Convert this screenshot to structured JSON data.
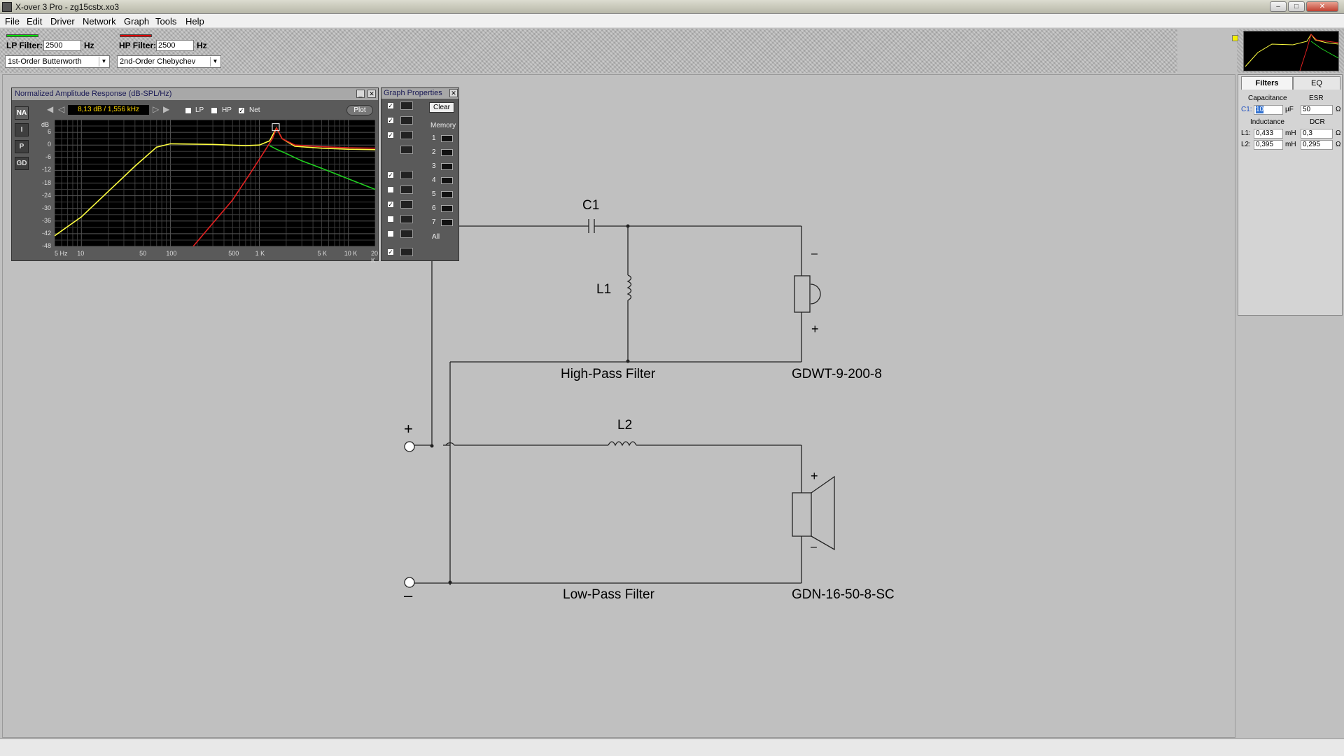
{
  "window": {
    "title": "X-over 3 Pro  -  zg15cstx.xo3",
    "min_label": "–",
    "max_label": "□",
    "close_label": "✕"
  },
  "menu": [
    "File",
    "Edit",
    "Driver",
    "Network",
    "Graph",
    "Tools",
    "Help"
  ],
  "lp_filter": {
    "label": "LP Filter:",
    "value": "2500",
    "unit": "Hz",
    "type": "1st-Order Butterworth",
    "color": "#00e000"
  },
  "hp_filter": {
    "label": "HP Filter:",
    "value": "2500",
    "unit": "Hz",
    "type": "2nd-Order Chebychev",
    "color": "#e00000"
  },
  "graph": {
    "title": "Normalized Amplitude Response (dB-SPL/Hz)",
    "readout": "8,13 dB / 1,556 kHz",
    "modes": [
      "NA",
      "I",
      "P",
      "GD"
    ],
    "checks": [
      {
        "label": "LP",
        "checked": false
      },
      {
        "label": "HP",
        "checked": false
      },
      {
        "label": "Net",
        "checked": true
      }
    ],
    "plot_label": "Plot",
    "y_unit": "dB",
    "close_label": "✕",
    "min_label": "_"
  },
  "chart_data": {
    "type": "line",
    "x_scale": "log",
    "xlim": [
      5,
      20000
    ],
    "ylim": [
      -48,
      12
    ],
    "x_ticks": [
      "5 Hz",
      "10",
      "50",
      "100",
      "500",
      "1 K",
      "5 K",
      "10 K",
      "20 K"
    ],
    "x_tick_values": [
      5,
      10,
      50,
      100,
      500,
      1000,
      5000,
      10000,
      20000
    ],
    "y_ticks": [
      "6",
      "0",
      "-6",
      "-12",
      "-18",
      "-24",
      "-30",
      "-36",
      "-42",
      "-48"
    ],
    "y_tick_values": [
      6,
      0,
      -6,
      -12,
      -18,
      -24,
      -30,
      -36,
      -42,
      -48
    ],
    "series": [
      {
        "color": "#ffff40",
        "points": [
          [
            5,
            -43
          ],
          [
            10,
            -34
          ],
          [
            20,
            -22
          ],
          [
            40,
            -10
          ],
          [
            70,
            -1
          ],
          [
            100,
            0.6
          ],
          [
            300,
            0.3
          ],
          [
            700,
            -0.3
          ],
          [
            1000,
            0
          ],
          [
            1300,
            2
          ],
          [
            1556,
            8.13
          ],
          [
            1800,
            3
          ],
          [
            2500,
            -0.6
          ],
          [
            5000,
            -1.5
          ],
          [
            10000,
            -2
          ],
          [
            20000,
            -2.2
          ]
        ]
      },
      {
        "color": "#e02020",
        "points": [
          [
            180,
            -48
          ],
          [
            300,
            -37
          ],
          [
            500,
            -26
          ],
          [
            800,
            -13
          ],
          [
            1100,
            -4
          ],
          [
            1400,
            3
          ],
          [
            1556,
            8.1
          ],
          [
            1800,
            3
          ],
          [
            2500,
            0
          ],
          [
            5000,
            -0.8
          ],
          [
            10000,
            -1.3
          ],
          [
            20000,
            -1.5
          ]
        ]
      },
      {
        "color": "#20d020",
        "points": [
          [
            1300,
            -0.3
          ],
          [
            1556,
            -2
          ],
          [
            2000,
            -4
          ],
          [
            3000,
            -7.5
          ],
          [
            5000,
            -11
          ],
          [
            10000,
            -16
          ],
          [
            20000,
            -21
          ]
        ]
      }
    ]
  },
  "graph_props": {
    "title": "Graph Properties",
    "clear_label": "Clear",
    "memory_label": "Memory",
    "memory_slots": [
      "1",
      "2",
      "3",
      "4",
      "5",
      "6",
      "7"
    ],
    "all_label": "All",
    "close_label": "✕"
  },
  "right_panel": {
    "tabs": [
      "Filters",
      "EQ"
    ],
    "cap_header": "Capacitance",
    "esr_header": "ESR",
    "ind_header": "Inductance",
    "dcr_header": "DCR",
    "c1": {
      "label": "C1:",
      "value": "10",
      "unit": "µF",
      "esr": "50",
      "esr_unit": "Ω"
    },
    "l1": {
      "label": "L1:",
      "value": "0,433",
      "unit": "mH",
      "dcr": "0,3",
      "dcr_unit": "Ω"
    },
    "l2": {
      "label": "L2:",
      "value": "0,395",
      "unit": "mH",
      "dcr": "0,295",
      "dcr_unit": "Ω"
    }
  },
  "schematic": {
    "c1_label": "C1",
    "l1_label": "L1",
    "l2_label": "L2",
    "hp_title": "High-Pass Filter",
    "lp_title": "Low-Pass Filter",
    "tweeter": "GDWT-9-200-8",
    "woofer": "GDN-16-50-8-SC",
    "plus": "+",
    "minus": "–"
  }
}
